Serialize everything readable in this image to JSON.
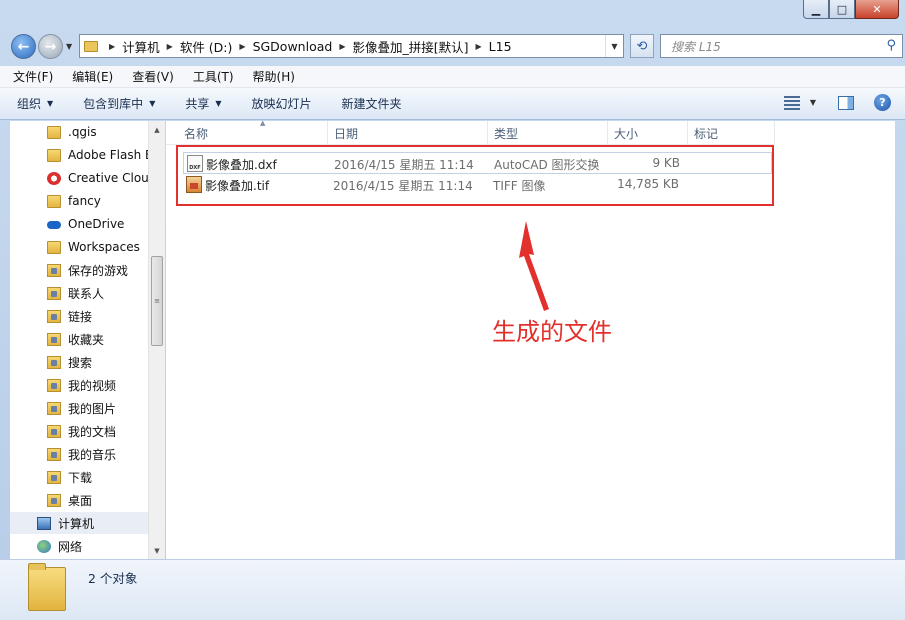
{
  "window": {
    "min": "▁",
    "max": "□",
    "close": "✕"
  },
  "address": {
    "crumbs": [
      "计算机",
      "软件 (D:)",
      "SGDownload",
      "影像叠加_拼接[默认]",
      "L15"
    ],
    "refresh_icon": "⟲",
    "search_placeholder": "搜索 L15",
    "search_icon": "⚲"
  },
  "menubar": {
    "items": [
      "文件(F)",
      "编辑(E)",
      "查看(V)",
      "工具(T)",
      "帮助(H)"
    ]
  },
  "commandbar": {
    "organize": "组织",
    "include_in_library": "包含到库中",
    "share": "共享",
    "slideshow": "放映幻灯片",
    "new_folder": "新建文件夹",
    "help": "?"
  },
  "navpane": {
    "items": [
      {
        "label": ".qgis",
        "icon": "folder-icon"
      },
      {
        "label": "Adobe Flash Builder",
        "icon": "folder-icon"
      },
      {
        "label": "Creative Cloud Files",
        "icon": "creative-cloud-icon"
      },
      {
        "label": "fancy",
        "icon": "folder-icon"
      },
      {
        "label": "OneDrive",
        "icon": "onedrive-icon"
      },
      {
        "label": "Workspaces",
        "icon": "folder-icon"
      },
      {
        "label": "保存的游戏",
        "icon": "saved-games-icon"
      },
      {
        "label": "联系人",
        "icon": "contacts-icon"
      },
      {
        "label": "链接",
        "icon": "links-icon"
      },
      {
        "label": "收藏夹",
        "icon": "favorites-icon"
      },
      {
        "label": "搜索",
        "icon": "searches-icon"
      },
      {
        "label": "我的视频",
        "icon": "videos-icon"
      },
      {
        "label": "我的图片",
        "icon": "pictures-icon"
      },
      {
        "label": "我的文档",
        "icon": "documents-icon"
      },
      {
        "label": "我的音乐",
        "icon": "music-icon"
      },
      {
        "label": "下载",
        "icon": "downloads-icon"
      },
      {
        "label": "桌面",
        "icon": "desktop-icon"
      }
    ],
    "computer": "计算机",
    "network": "网络"
  },
  "columns": {
    "name": "名称",
    "date": "日期",
    "type": "类型",
    "size": "大小",
    "tags": "标记"
  },
  "files": [
    {
      "name": "影像叠加.dxf",
      "date": "2016/4/15 星期五 11:14",
      "type": "AutoCAD 图形交换",
      "size": "9 KB",
      "icon_text": "DXF"
    },
    {
      "name": "影像叠加.tif",
      "date": "2016/4/15 星期五 11:14",
      "type": "TIFF 图像",
      "size": "14,785 KB",
      "icon_text": ""
    }
  ],
  "annotation": "生成的文件",
  "status": {
    "count": "2 个对象"
  },
  "colors": {
    "annotation_red": "#e2302c",
    "selection_border": "#c2d1e4"
  }
}
